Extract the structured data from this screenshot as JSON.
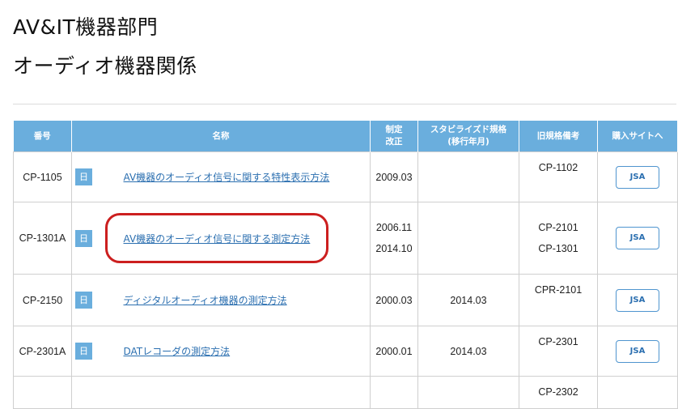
{
  "page": {
    "title_line1": "AV&IT機器部門",
    "title_line2": "オーディオ機器関係"
  },
  "table": {
    "headers": {
      "number": "番号",
      "name": "名称",
      "revised": [
        "制定",
        "改正"
      ],
      "stabilized": [
        "スタビライズド規格",
        "(移行年月)"
      ],
      "old_notes": "旧規格備考",
      "purchase": "購入サイトへ"
    },
    "lang_badge": "日",
    "button_label": "JSA",
    "rows": [
      {
        "number": "CP-1105",
        "name": "AV機器のオーディオ信号に関する特性表示方法",
        "revised": [
          "2009.03"
        ],
        "stabilized": "",
        "old": [
          "CP-1102"
        ]
      },
      {
        "number": "CP-1301A",
        "name": "AV機器のオーディオ信号に関する測定方法",
        "revised": [
          "2006.11",
          "2014.10"
        ],
        "stabilized": "",
        "old": [
          "CP-2101",
          "CP-1301"
        ]
      },
      {
        "number": "CP-2150",
        "name": "ディジタルオーディオ機器の測定方法",
        "revised": [
          "2000.03"
        ],
        "stabilized": "2014.03",
        "old": [
          "CPR-2101"
        ]
      },
      {
        "number": "CP-2301A",
        "name": "DATレコーダの測定方法",
        "revised": [
          "2000.01"
        ],
        "stabilized": "2014.03",
        "old": [
          "CP-2301"
        ]
      },
      {
        "number": "",
        "name": "",
        "revised": [],
        "stabilized": "",
        "old": [
          "CP-2302"
        ]
      }
    ]
  },
  "colors": {
    "header_bg": "#6aaedd",
    "link": "#2b6fb0",
    "highlight": "#cc1f1f"
  }
}
